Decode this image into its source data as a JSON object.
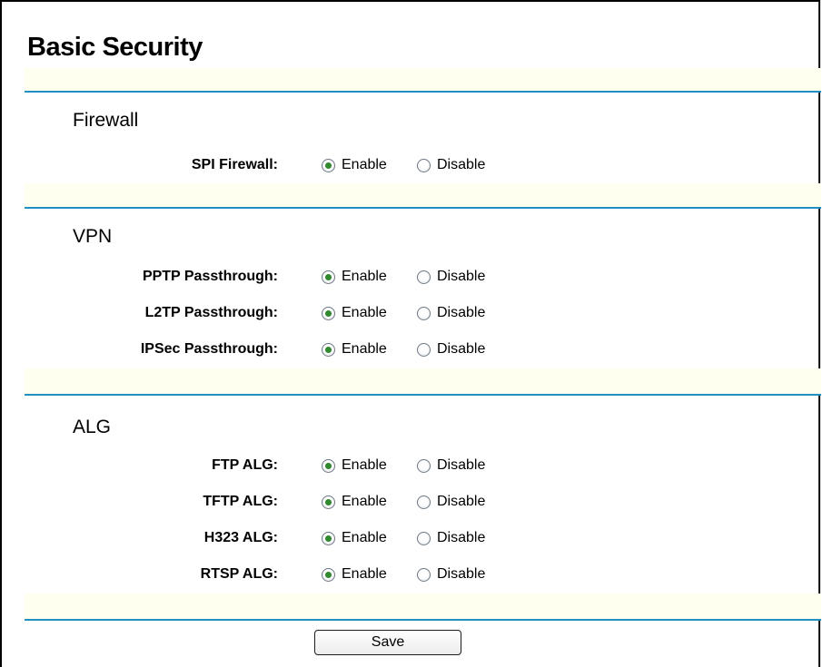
{
  "page": {
    "title": "Basic Security"
  },
  "options": {
    "enable": "Enable",
    "disable": "Disable"
  },
  "firewall": {
    "heading": "Firewall",
    "rows": [
      {
        "label": "SPI Firewall:",
        "selected": "enable"
      }
    ]
  },
  "vpn": {
    "heading": "VPN",
    "rows": [
      {
        "label": "PPTP Passthrough:",
        "selected": "enable"
      },
      {
        "label": "L2TP Passthrough:",
        "selected": "enable"
      },
      {
        "label": "IPSec Passthrough:",
        "selected": "enable"
      }
    ]
  },
  "alg": {
    "heading": "ALG",
    "rows": [
      {
        "label": "FTP ALG:",
        "selected": "enable"
      },
      {
        "label": "TFTP ALG:",
        "selected": "enable"
      },
      {
        "label": "H323 ALG:",
        "selected": "enable"
      },
      {
        "label": "RTSP ALG:",
        "selected": "enable"
      }
    ]
  },
  "actions": {
    "save_label": "Save"
  },
  "colors": {
    "rule": "#1f8fc4",
    "band": "#fffff0",
    "radio_dot": "#2f8a2f"
  }
}
